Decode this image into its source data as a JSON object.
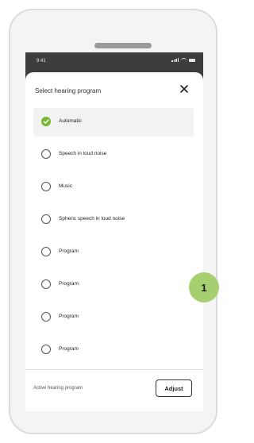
{
  "status_bar": {
    "time": "9:41",
    "icons": [
      "signal-icon",
      "wifi-icon",
      "battery-icon"
    ]
  },
  "sheet": {
    "title": "Select hearing program",
    "close_icon": "close-icon"
  },
  "programs": [
    {
      "label": "Automatic",
      "selected": true
    },
    {
      "label": "Speech in loud noise",
      "selected": false
    },
    {
      "label": "Music",
      "selected": false
    },
    {
      "label": "Spheric speech in loud noise",
      "selected": false
    },
    {
      "label": "Program",
      "selected": false
    },
    {
      "label": "Program",
      "selected": false
    },
    {
      "label": "Program",
      "selected": false
    },
    {
      "label": "Program",
      "selected": false
    }
  ],
  "footer": {
    "label": "Active hearing program",
    "adjust_label": "Adjust"
  },
  "callout": {
    "number": "1"
  },
  "colors": {
    "accent_green": "#75b830",
    "callout_green": "#a6cf6f",
    "screen_dark": "#3d3d3d"
  }
}
